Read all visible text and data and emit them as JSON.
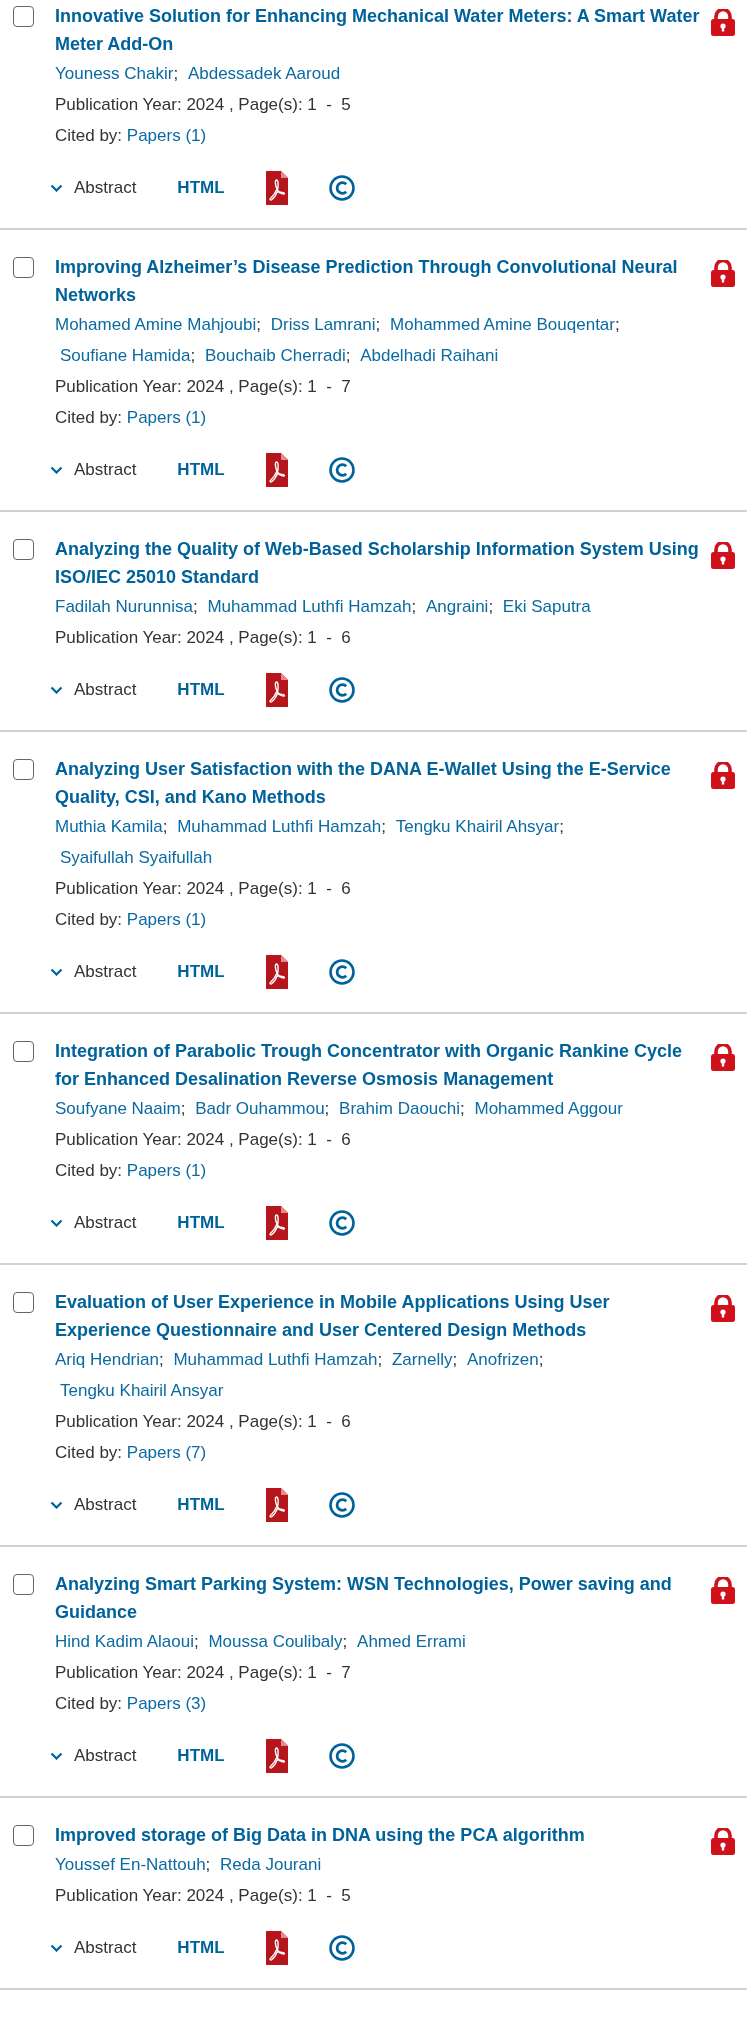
{
  "author_separator": ";",
  "results": [
    {
      "title": "Innovative Solution for Enhancing Mechanical Water Meters: A Smart Water Meter Add-On",
      "checked": false,
      "authors": [
        "Youness Chakir",
        "Abdessadek Aaroud"
      ],
      "publication": "Publication Year: 2024 , Page(s): 1  -  5",
      "cited_label": "Cited by:",
      "cited_link": "Papers (1)",
      "abstract": "Abstract",
      "html": "HTML"
    },
    {
      "title": "Improving Alzheimer’s Disease Prediction Through Convolutional Neural Networks",
      "checked": false,
      "authors": [
        "Mohamed Amine Mahjoubi",
        "Driss Lamrani",
        "Mohammed Amine Bouqentar",
        "Soufiane Hamida",
        "Bouchaib Cherradi",
        "Abdelhadi Raihani"
      ],
      "publication": "Publication Year: 2024 , Page(s): 1  -  7",
      "cited_label": "Cited by:",
      "cited_link": "Papers (1)",
      "abstract": "Abstract",
      "html": "HTML"
    },
    {
      "title": "Analyzing the Quality of Web-Based Scholarship Information System Using ISO/IEC 25010 Standard",
      "checked": false,
      "authors": [
        "Fadilah Nurunnisa",
        "Muhammad Luthfi Hamzah",
        "Angraini",
        "Eki Saputra"
      ],
      "publication": "Publication Year: 2024 , Page(s): 1  -  6",
      "abstract": "Abstract",
      "html": "HTML"
    },
    {
      "title": "Analyzing User Satisfaction with the DANA E-Wallet Using the E-Service Quality, CSI, and Kano Methods",
      "checked": false,
      "authors": [
        "Muthia Kamila",
        "Muhammad Luthfi Hamzah",
        "Tengku Khairil Ahsyar",
        "Syaifullah Syaifullah"
      ],
      "publication": "Publication Year: 2024 , Page(s): 1  -  6",
      "cited_label": "Cited by:",
      "cited_link": "Papers (1)",
      "abstract": "Abstract",
      "html": "HTML"
    },
    {
      "title": "Integration of Parabolic Trough Concentrator with Organic Rankine Cycle for Enhanced Desalination Reverse Osmosis Management",
      "checked": false,
      "authors": [
        "Soufyane Naaim",
        "Badr Ouhammou",
        "Brahim Daouchi",
        "Mohammed Aggour"
      ],
      "publication": "Publication Year: 2024 , Page(s): 1  -  6",
      "cited_label": "Cited by:",
      "cited_link": "Papers (1)",
      "abstract": "Abstract",
      "html": "HTML"
    },
    {
      "title": "Evaluation of User Experience in Mobile Applications Using User Experience Questionnaire and User Centered Design Methods",
      "checked": false,
      "authors": [
        "Ariq Hendrian",
        "Muhammad Luthfi Hamzah",
        "Zarnelly",
        "Anofrizen",
        "Tengku Khairil Ansyar"
      ],
      "publication": "Publication Year: 2024 , Page(s): 1  -  6",
      "cited_label": "Cited by:",
      "cited_link": "Papers (7)",
      "abstract": "Abstract",
      "html": "HTML"
    },
    {
      "title": "Analyzing Smart Parking System: WSN Technologies, Power saving and Guidance",
      "checked": false,
      "authors": [
        "Hind Kadim Alaoui",
        "Moussa Coulibaly",
        "Ahmed Errami"
      ],
      "publication": "Publication Year: 2024 , Page(s): 1  -  7",
      "cited_label": "Cited by:",
      "cited_link": "Papers (3)",
      "abstract": "Abstract",
      "html": "HTML"
    },
    {
      "title": "Improved storage of Big Data in DNA using the PCA algorithm",
      "checked": false,
      "authors": [
        "Youssef En-Nattouh",
        "Reda Jourani"
      ],
      "publication": "Publication Year: 2024 , Page(s): 1  -  5",
      "abstract": "Abstract",
      "html": "HTML"
    }
  ]
}
